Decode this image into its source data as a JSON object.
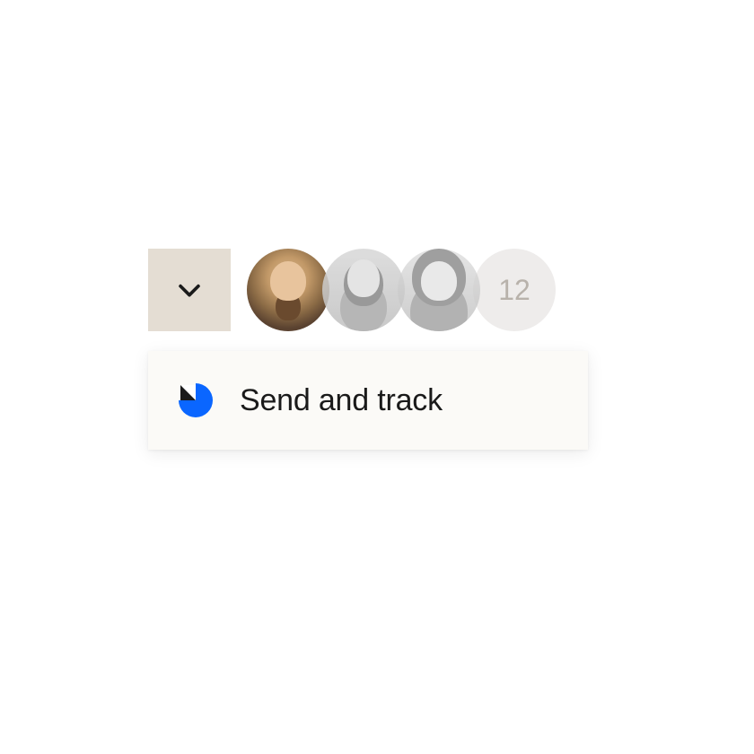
{
  "avatars": {
    "overflow_count": "12"
  },
  "menu": {
    "send_track_label": "Send and track"
  }
}
